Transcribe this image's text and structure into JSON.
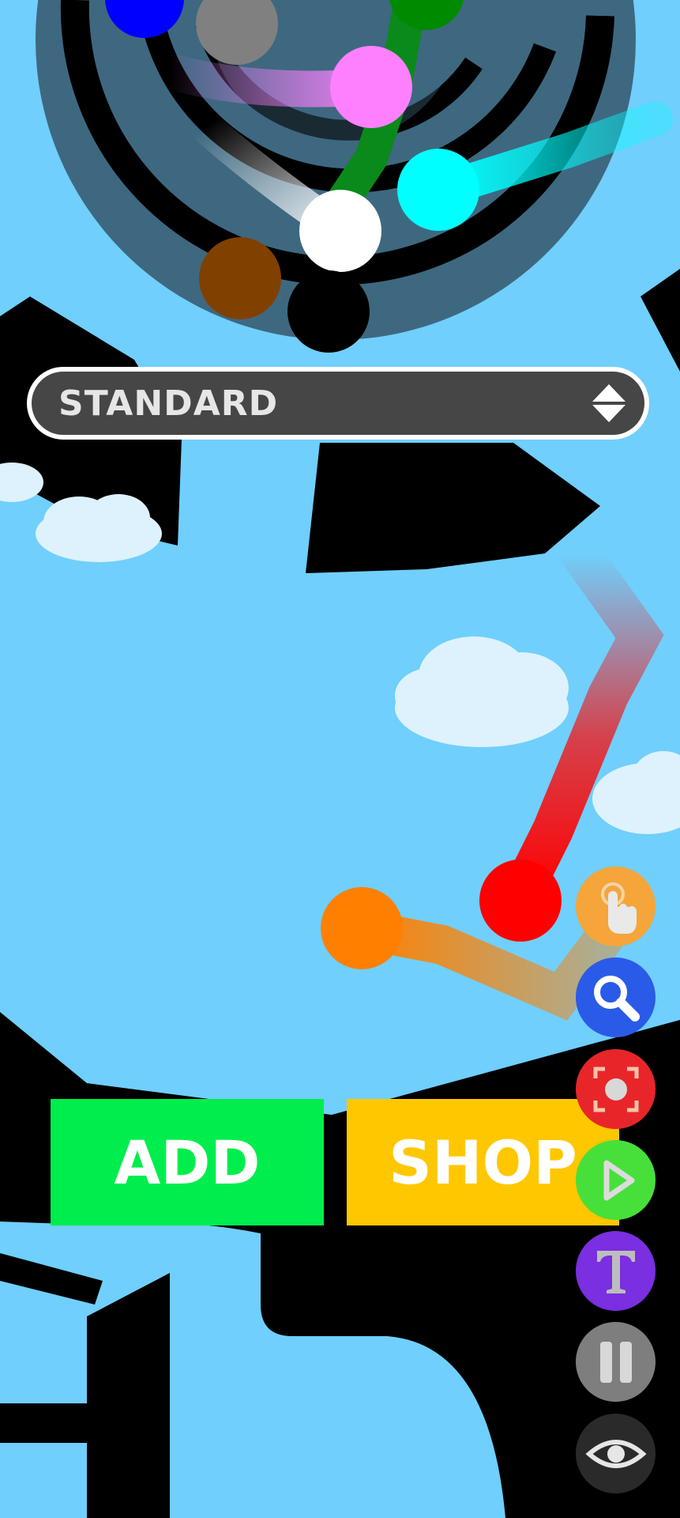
{
  "mode_selector": {
    "value": "STANDARD",
    "icon": "up-down-arrows-icon"
  },
  "buttons": {
    "add_label": "ADD",
    "shop_label": "SHOP"
  },
  "tools": [
    {
      "name": "tap-tool",
      "icon": "hand-pointer-icon",
      "color": "#F5A53A"
    },
    {
      "name": "zoom-tool",
      "icon": "magnifier-icon",
      "color": "#2A5BE8"
    },
    {
      "name": "capture-tool",
      "icon": "screenshot-frame-icon",
      "color": "#E8262A"
    },
    {
      "name": "play-tool",
      "icon": "play-icon",
      "color": "#47E03A"
    },
    {
      "name": "text-tool",
      "icon": "letter-t-icon",
      "color": "#7A2FE0"
    },
    {
      "name": "pause-tool",
      "icon": "pause-icon",
      "color": "#7E7E7E"
    },
    {
      "name": "visibility-tool",
      "icon": "eye-icon",
      "color": "#2A2A2A"
    }
  ],
  "colors": {
    "sky": "#70CFFC",
    "track": "#3E6880",
    "obstacle": "#000000"
  },
  "balls": [
    "blue",
    "gray",
    "green",
    "pink",
    "cyan",
    "white",
    "brown",
    "black",
    "red",
    "orange"
  ]
}
